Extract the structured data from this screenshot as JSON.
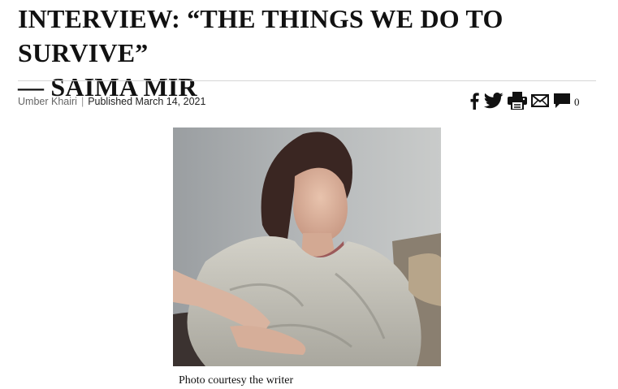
{
  "article": {
    "title_line1": "INTERVIEW: “THE THINGS WE DO TO SURVIVE”",
    "title_line2": "— SAIMA MIR",
    "author": "Umber Khairi",
    "separator": "|",
    "published": "Published March 14, 2021",
    "image_caption": "Photo courtesy the writer"
  },
  "share": {
    "icons": [
      "facebook-icon",
      "twitter-icon",
      "print-icon",
      "email-icon",
      "comment-icon"
    ],
    "comment_count": "0"
  },
  "colors": {
    "text": "#111111",
    "byline_author": "#666666",
    "rule": "#d6d6d6"
  }
}
